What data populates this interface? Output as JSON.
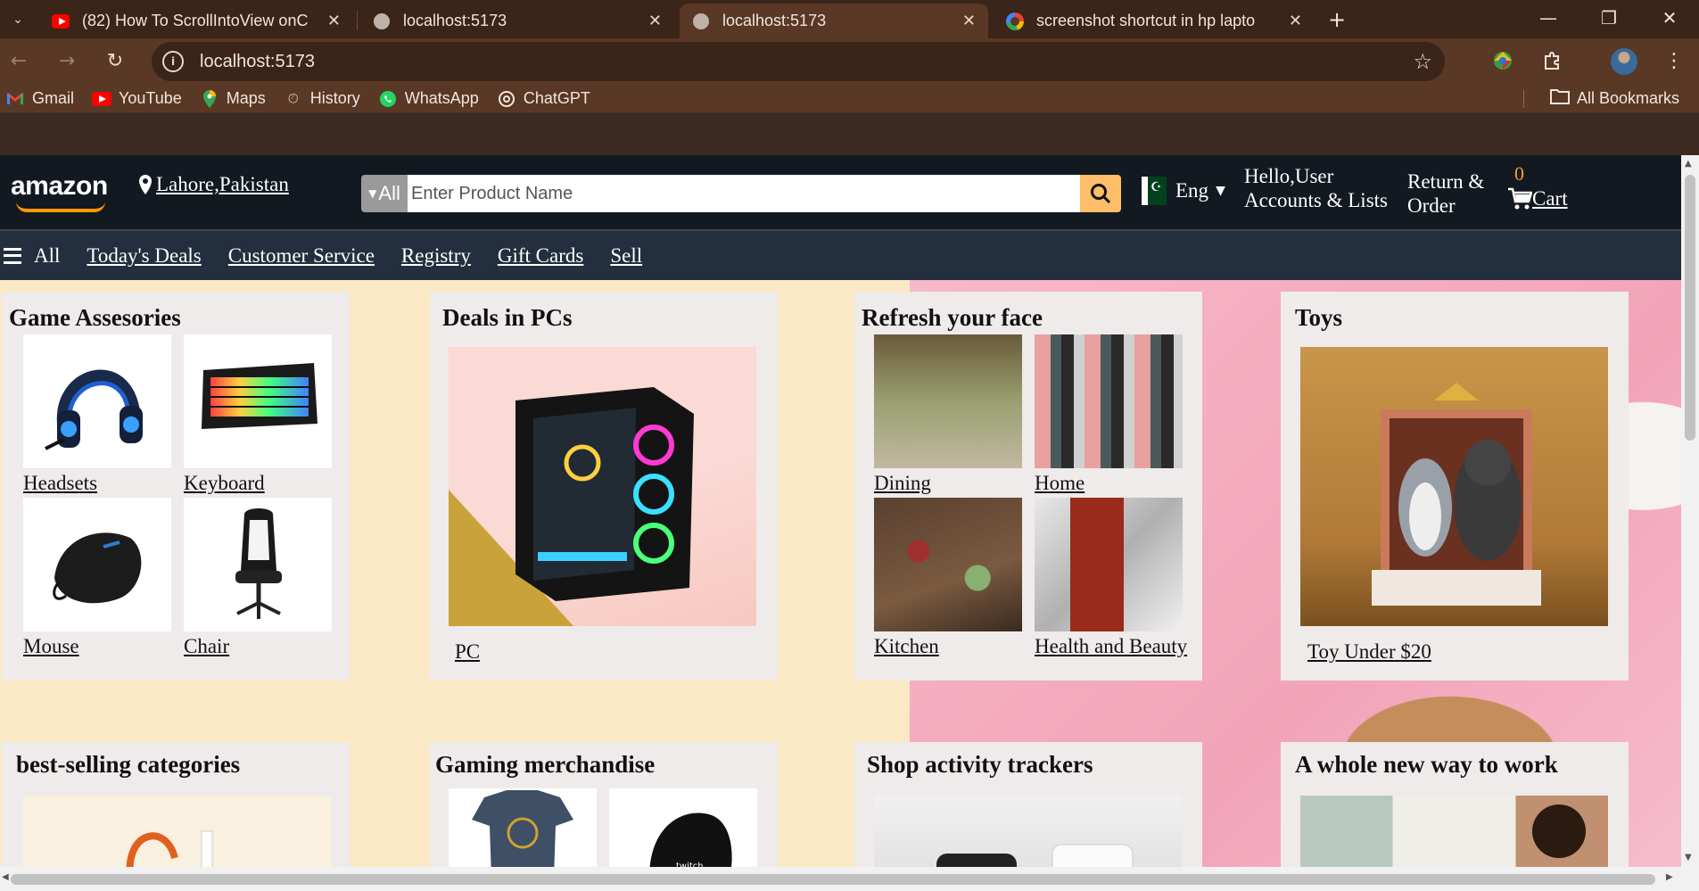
{
  "browser": {
    "tabs": [
      {
        "title": "(82) How To ScrollIntoView onC",
        "favicon": "youtube-icon",
        "active": false
      },
      {
        "title": "localhost:5173",
        "favicon": "globe-icon",
        "active": false
      },
      {
        "title": "localhost:5173",
        "favicon": "globe-icon",
        "active": true
      },
      {
        "title": "screenshot shortcut in hp lapto",
        "favicon": "google-icon",
        "active": false
      }
    ],
    "url": "localhost:5173",
    "bookmarks": [
      {
        "label": "Gmail",
        "icon": "gmail-icon"
      },
      {
        "label": "YouTube",
        "icon": "youtube-icon"
      },
      {
        "label": "Maps",
        "icon": "maps-icon"
      },
      {
        "label": "History",
        "icon": "history-icon"
      },
      {
        "label": "WhatsApp",
        "icon": "whatsapp-icon"
      },
      {
        "label": "ChatGPT",
        "icon": "chatgpt-icon"
      }
    ],
    "all_bookmarks": "All Bookmarks"
  },
  "header": {
    "logo": "amazon",
    "location": "Lahore,Pakistan",
    "search_category": "All",
    "search_placeholder": "Enter Product Name",
    "language": "Eng",
    "greeting": "Hello,User",
    "accounts": "Accounts & Lists",
    "returns_line1": "Return &",
    "returns_line2": "Order",
    "cart_count": "0",
    "cart_label": "Cart",
    "accent": "#febd69"
  },
  "nav": {
    "all": "All",
    "links": [
      "Today's Deals",
      "Customer Service",
      "Registry",
      "Gift Cards",
      "Sell"
    ]
  },
  "cards": {
    "game": {
      "title": "Game Assesories",
      "items": [
        "Headsets",
        "Keyboard",
        "Mouse",
        "Chair"
      ]
    },
    "pcs": {
      "title": "Deals in PCs",
      "link": "PC"
    },
    "face": {
      "title": "Refresh your face",
      "items": [
        "Dining",
        "Home",
        "Kitchen",
        "Health and Beauty"
      ]
    },
    "toys": {
      "title": "Toys",
      "link": "Toy Under $20"
    },
    "bestselling": {
      "title": "best-selling categories"
    },
    "gaming_merch": {
      "title": "Gaming merchandise"
    },
    "trackers": {
      "title": "Shop activity trackers"
    },
    "work": {
      "title": "A whole new way to work"
    }
  }
}
